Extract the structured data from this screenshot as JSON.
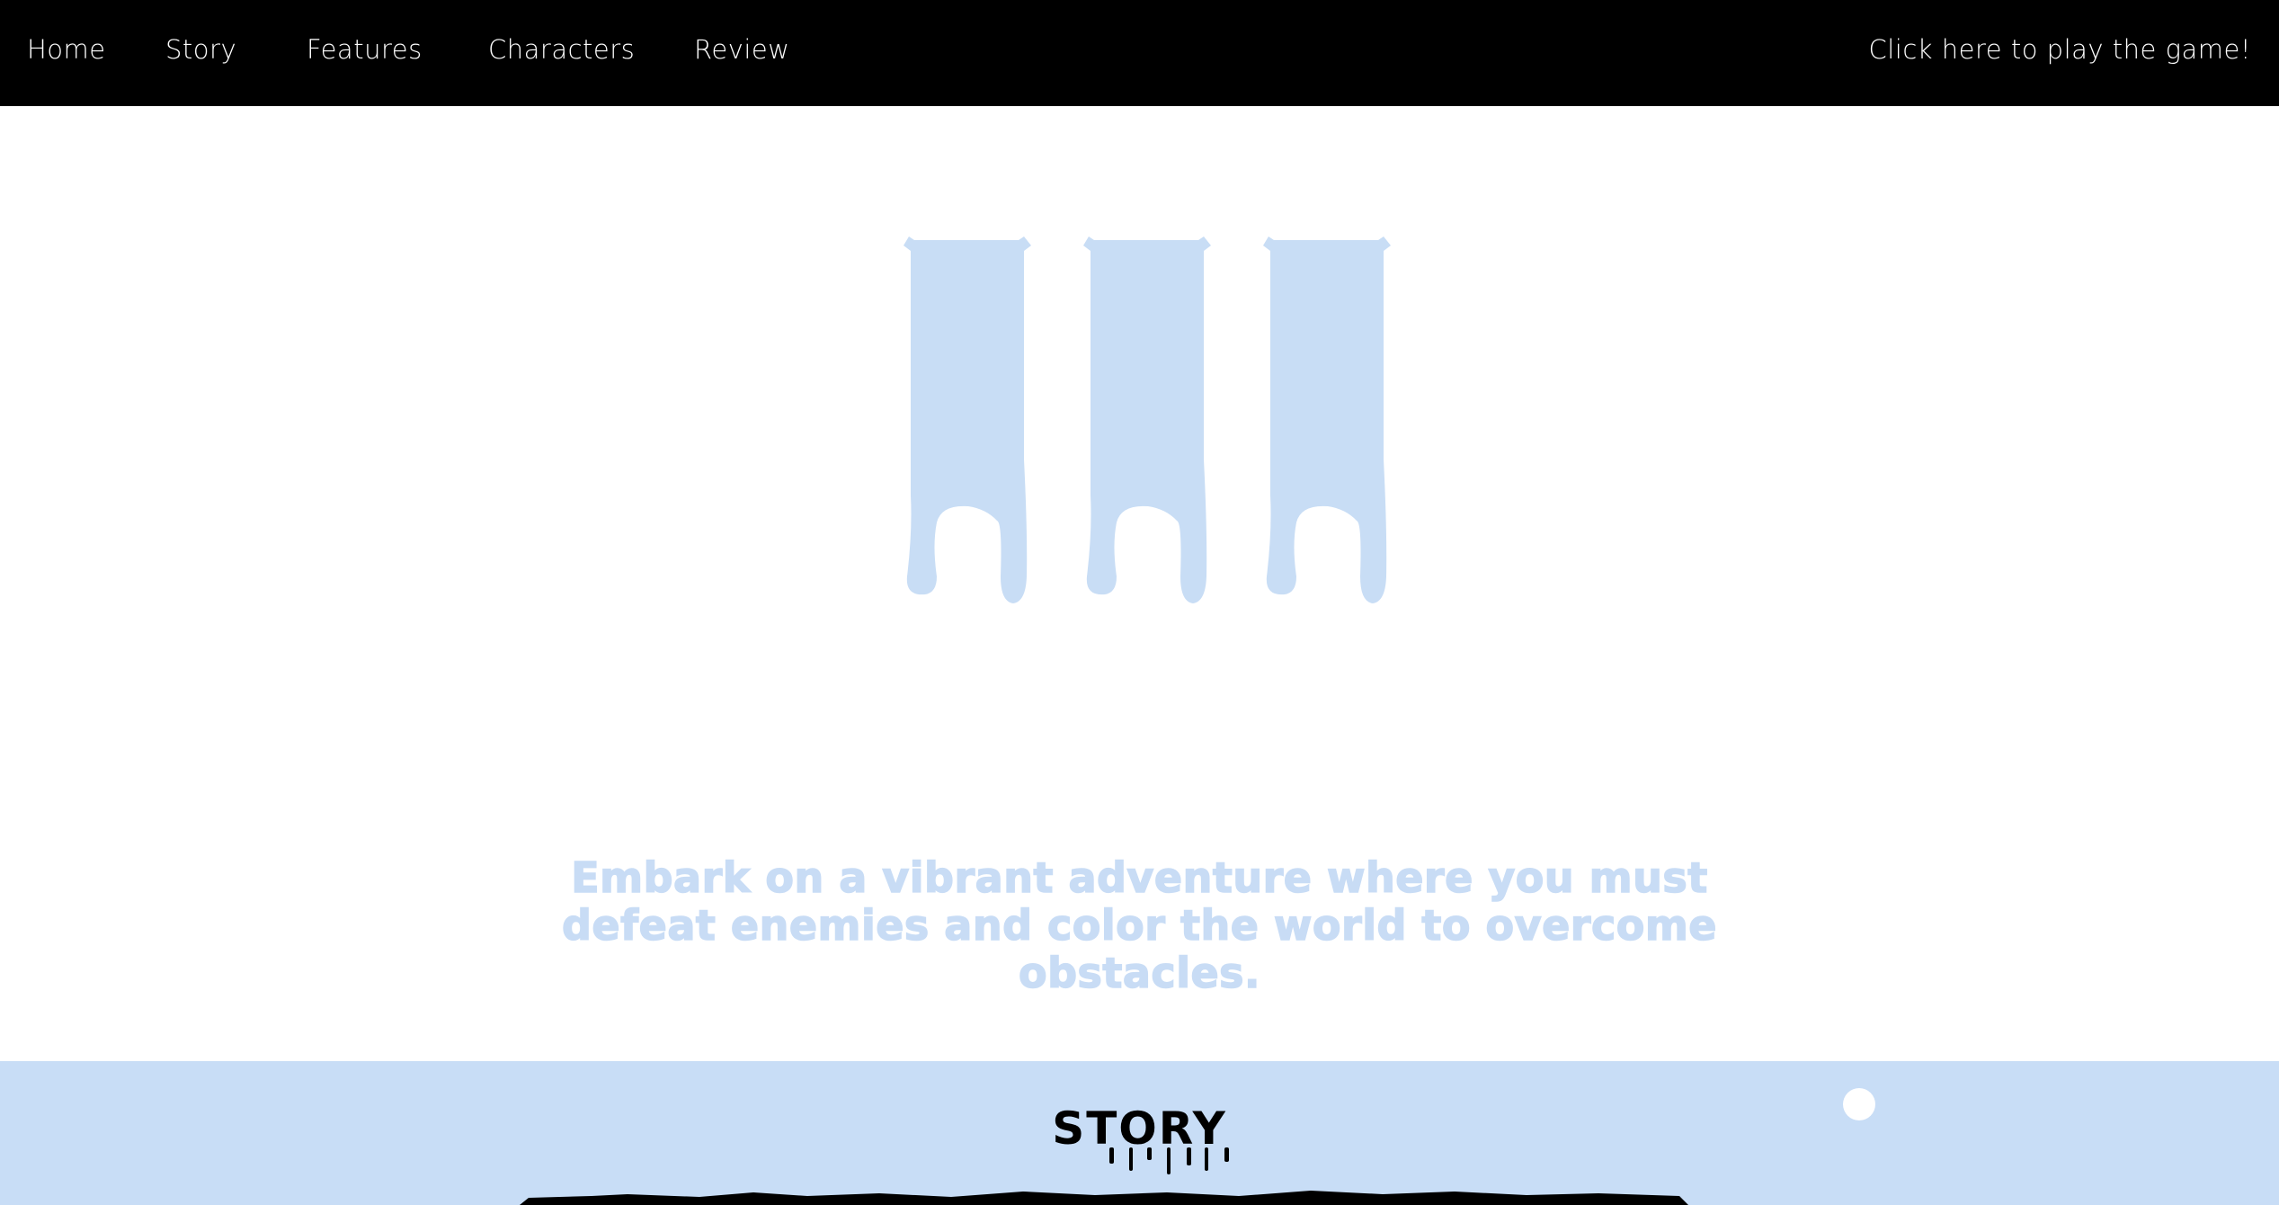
{
  "nav": {
    "home": "Home",
    "story": "Story",
    "features": "Features",
    "characters": "Characters",
    "review": "Review",
    "play": "Click here to play the game!"
  },
  "hero": {
    "logo_icon": "triple-drip-logo",
    "tagline": "Embark on a vibrant adventure where you must defeat enemies and color the world to overcome obstacles."
  },
  "story": {
    "heading": "STORY"
  },
  "colors": {
    "navbar": "#000000",
    "accent_light_blue": "#c8ddf6",
    "text_white": "#ffffff"
  }
}
